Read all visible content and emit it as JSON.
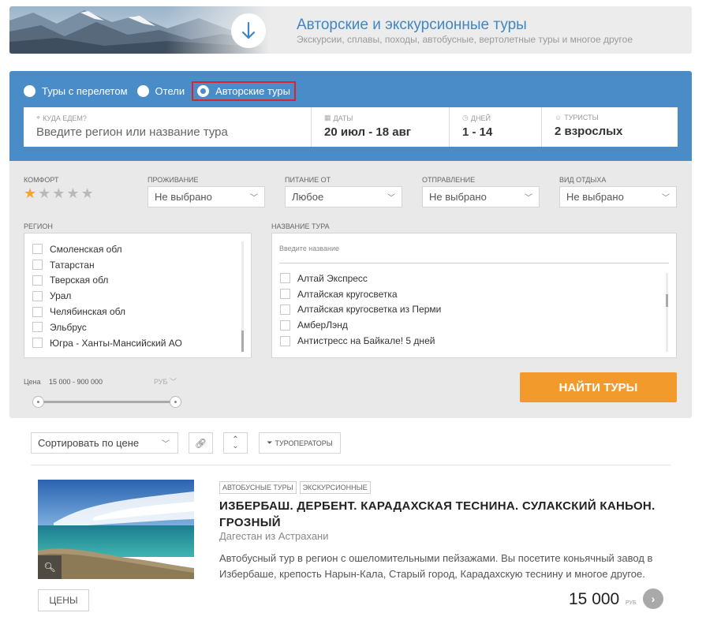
{
  "banner": {
    "title": "Авторские и экскурсионные туры",
    "subtitle": "Экскурсии, сплавы, походы, автобусные, вертолетные туры и многое другое",
    "icon": "arrow-down-icon"
  },
  "search": {
    "radios": [
      {
        "label": "Туры с перелетом",
        "selected": false
      },
      {
        "label": "Отели",
        "selected": false
      },
      {
        "label": "Авторские туры",
        "selected": true
      }
    ],
    "destination": {
      "label": "Куда едем?",
      "placeholder": "Введите регион или название тура"
    },
    "dates": {
      "label": "Даты",
      "value": "20 июл - 18 авг"
    },
    "days": {
      "label": "Дней",
      "value": "1 - 14"
    },
    "tourists": {
      "label": "Туристы",
      "value": "2 взрослых"
    }
  },
  "filters": {
    "comfort": {
      "label": "Комфорт",
      "rating": 1,
      "max": 5
    },
    "accommodation": {
      "label": "Проживание",
      "value": "Не выбрано"
    },
    "meals": {
      "label": "Питание от",
      "value": "Любое"
    },
    "departure": {
      "label": "Отправление",
      "value": "Не выбрано"
    },
    "holiday_type": {
      "label": "Вид отдыха",
      "value": "Не выбрано"
    },
    "region": {
      "label": "Регион",
      "items": [
        "Смоленская обл",
        "Татарстан",
        "Тверская обл",
        "Урал",
        "Челябинская обл",
        "Эльбрус",
        "Югра - Ханты-Мансийский АО"
      ]
    },
    "tour_name": {
      "label": "Название тура",
      "search_placeholder": "Введите название",
      "items": [
        "Алтай Экспресс",
        "Алтайская кругосветка",
        "Алтайская кругосветка из Перми",
        "АмберЛэнд",
        "Антистресс на Байкале! 5 дней"
      ]
    },
    "price": {
      "label": "Цена",
      "range": "15 000 - 900 000",
      "currency": "РУБ",
      "min_fraction": 0.0,
      "max_fraction": 1.0
    },
    "find_button": "НАЙТИ ТУРЫ"
  },
  "sort": {
    "value": "Сортировать по цене",
    "operators_button": "ТУРОПЕРАТОРЫ"
  },
  "tour": {
    "tags": [
      "АВТОБУСНЫЕ ТУРЫ",
      "ЭКСКУРСИОННЫЕ"
    ],
    "title": "ИЗБЕРБАШ. ДЕРБЕНТ. КАРАДАХСКАЯ ТЕСНИНА. СУЛАКСКИЙ КАНЬОН. ГРОЗНЫЙ",
    "location": "Дагестан из Астрахани",
    "description": "Автобусный тур в регион с ошеломительными пейзажами. Вы посетите коньячный завод в Избербаше, крепость Нарын-Кала, Старый город, Карадахскую теснину и многое другое.",
    "prices_button": "ЦЕНЫ",
    "price": "15 000",
    "currency": "РУБ"
  },
  "colors": {
    "primary_blue": "#4a8cc7",
    "accent_orange": "#f39a2c",
    "highlight_red": "#d9232d",
    "star_gold": "#f5a623"
  }
}
